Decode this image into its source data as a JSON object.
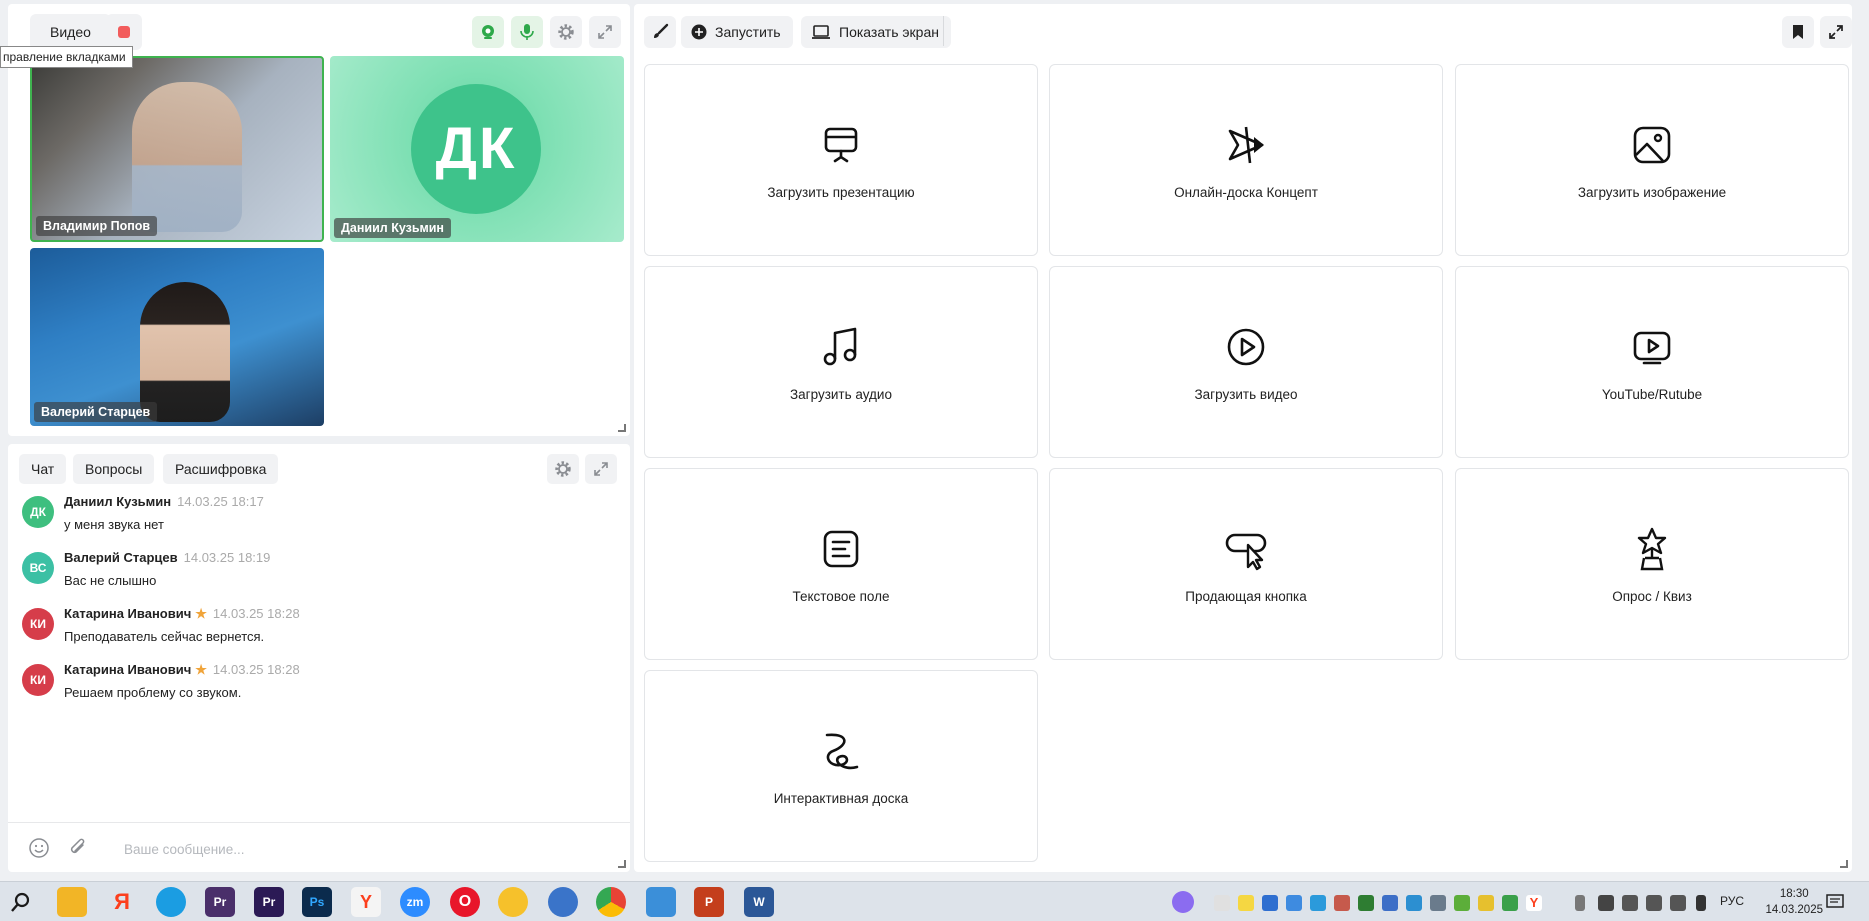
{
  "video_panel": {
    "video_label": "Видео",
    "tooltip": "правление вкладками",
    "participants": [
      {
        "name": "Владимир Попов"
      },
      {
        "name": "Даниил Кузьмин",
        "initials": "ДК"
      },
      {
        "name": "Валерий Старцев"
      }
    ]
  },
  "chat": {
    "tabs": [
      "Чат",
      "Вопросы",
      "Расшифровка"
    ],
    "messages": [
      {
        "initials": "ДК",
        "author": "Даниил Кузьмин",
        "time": "14.03.25 18:17",
        "text": "у меня звука нет",
        "color": "#3ebf7f",
        "star": false
      },
      {
        "initials": "ВС",
        "author": "Валерий Старцев",
        "time": "14.03.25 18:19",
        "text": "Вас не слышно",
        "color": "#3cc0a4",
        "star": false
      },
      {
        "initials": "КИ",
        "author": "Катарина Иванович",
        "time": "14.03.25 18:28",
        "text": "Преподаватель сейчас вернется.",
        "color": "#d63d4a",
        "star": true
      },
      {
        "initials": "КИ",
        "author": "Катарина Иванович",
        "time": "14.03.25 18:28",
        "text": "Решаем проблему со звуком.",
        "color": "#d63d4a",
        "star": true
      }
    ],
    "input_placeholder": "Ваше сообщение..."
  },
  "toolbar": {
    "run_label": "Запустить",
    "share_label": "Показать экран"
  },
  "cards": [
    {
      "label": "Загрузить презентацию",
      "icon": "presentation-icon"
    },
    {
      "label": "Онлайн-доска Концепт",
      "icon": "star-board-icon"
    },
    {
      "label": "Загрузить изображение",
      "icon": "image-icon"
    },
    {
      "label": "Загрузить аудио",
      "icon": "music-note-icon"
    },
    {
      "label": "Загрузить видео",
      "icon": "play-circle-icon"
    },
    {
      "label": "YouTube/Rutube",
      "icon": "youtube-icon"
    },
    {
      "label": "Текстовое поле",
      "icon": "text-field-icon"
    },
    {
      "label": "Продающая кнопка",
      "icon": "click-button-icon"
    },
    {
      "label": "Опрос / Квиз",
      "icon": "trophy-icon"
    },
    {
      "label": "Интерактивная доска",
      "icon": "drawing-icon"
    }
  ],
  "taskbar": {
    "lang": "РУС",
    "time": "18:30",
    "date": "14.03.2025",
    "apps": [
      {
        "name": "search-app",
        "label": "",
        "color": "#1b1b1b"
      },
      {
        "name": "file-explorer-app",
        "label": "",
        "color": "#f2b526"
      },
      {
        "name": "yandex-app",
        "label": "Я",
        "color": "#fc3f1d"
      },
      {
        "name": "edge-app",
        "label": "",
        "color": "#1b9de2"
      },
      {
        "name": "premiere-pro-app-1",
        "label": "Pr",
        "color": "#4a2f6a"
      },
      {
        "name": "premiere-pro-app-2",
        "label": "Pr",
        "color": "#2b1a55"
      },
      {
        "name": "photoshop-app",
        "label": "Ps",
        "color": "#0b2b4d"
      },
      {
        "name": "yandex-browser-app",
        "label": "Y",
        "color": "#f4f4f4"
      },
      {
        "name": "zoom-app",
        "label": "zm",
        "color": "#2d8cff"
      },
      {
        "name": "opera-app",
        "label": "O",
        "color": "#e8162a"
      },
      {
        "name": "smiley-app",
        "label": "",
        "color": "#f6c12b"
      },
      {
        "name": "globe-app",
        "label": "",
        "color": "#3a74c9"
      },
      {
        "name": "chrome-app",
        "label": "",
        "color": "#e84335"
      },
      {
        "name": "phone-app",
        "label": "",
        "color": "#3b8fd9"
      },
      {
        "name": "powerpoint-app",
        "label": "P",
        "color": "#c43e1c"
      },
      {
        "name": "word-app",
        "label": "W",
        "color": "#2b5797"
      }
    ]
  }
}
